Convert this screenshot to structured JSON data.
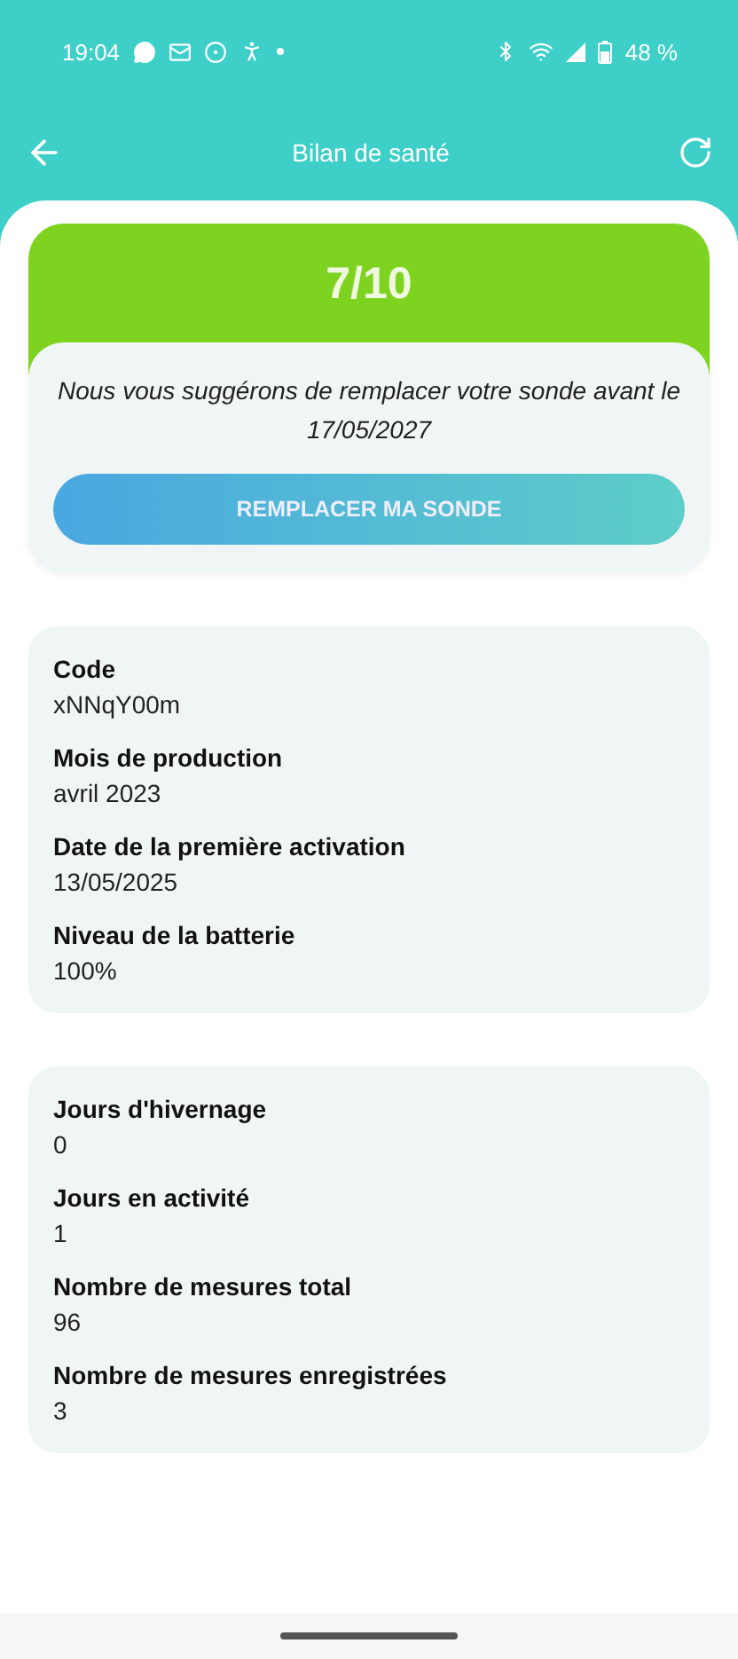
{
  "status_bar": {
    "time": "19:04",
    "battery": "48 %"
  },
  "header": {
    "title": "Bilan de santé"
  },
  "score_card": {
    "score": "7/10",
    "message": "Nous vous suggérons de remplacer votre sonde avant le 17/05/2027",
    "button": "REMPLACER MA SONDE"
  },
  "sections": [
    {
      "fields": [
        {
          "label": "Code",
          "value": "xNNqY00m"
        },
        {
          "label": "Mois de production",
          "value": "avril 2023"
        },
        {
          "label": "Date de la première activation",
          "value": "13/05/2025"
        },
        {
          "label": "Niveau de la batterie",
          "value": "100%"
        }
      ]
    },
    {
      "fields": [
        {
          "label": "Jours d'hivernage",
          "value": "0"
        },
        {
          "label": "Jours en activité",
          "value": "1"
        },
        {
          "label": "Nombre de mesures total",
          "value": "96"
        },
        {
          "label": "Nombre de mesures enregistrées",
          "value": "3"
        }
      ]
    }
  ]
}
